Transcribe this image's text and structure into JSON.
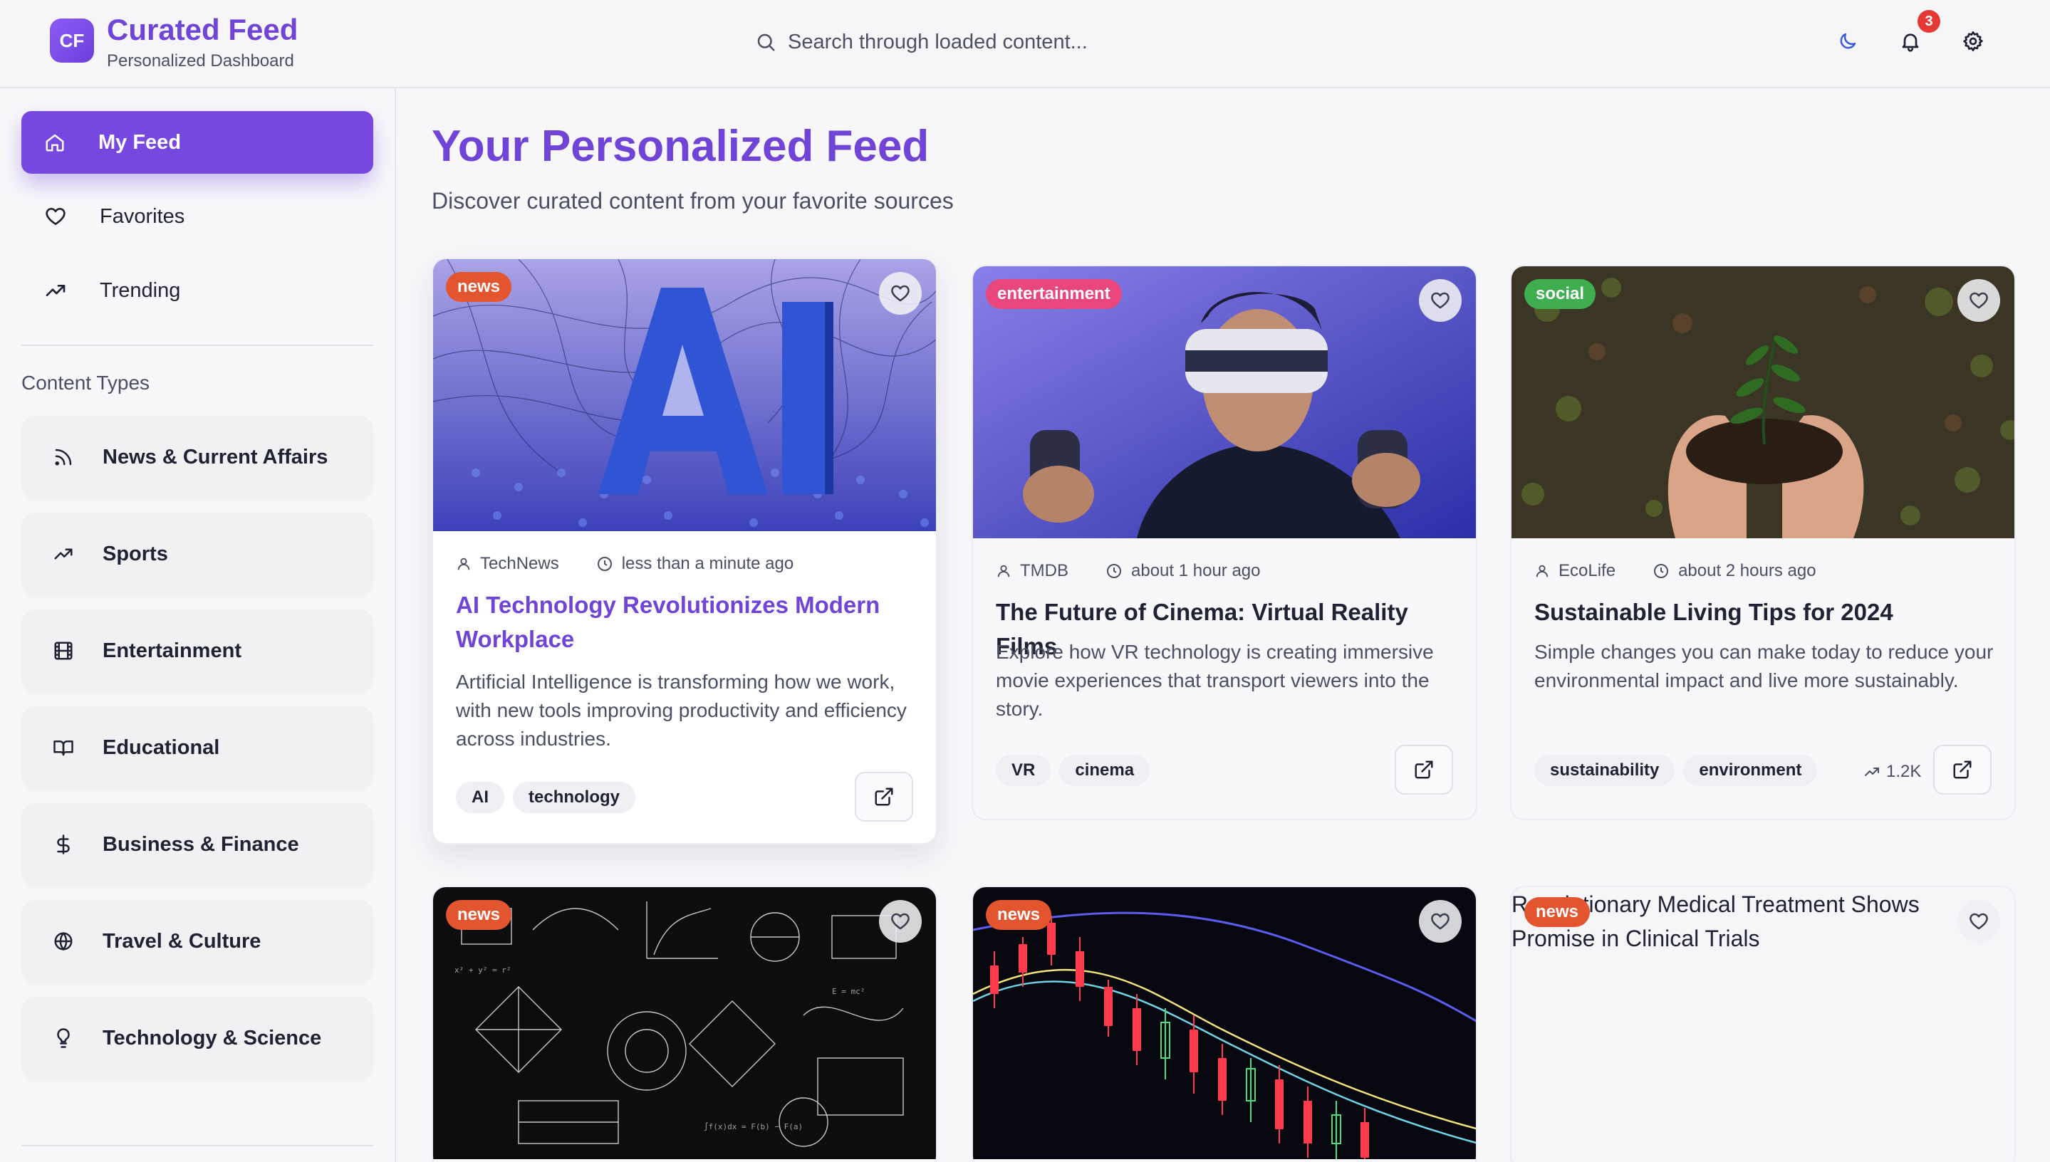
{
  "app": {
    "logo_initials": "CF",
    "title": "Curated Feed",
    "subtitle": "Personalized Dashboard"
  },
  "search": {
    "placeholder": "Search through loaded content...",
    "value": ""
  },
  "header_icons": {
    "theme": "moon-icon",
    "notifications": "bell-icon",
    "notification_count": "3",
    "settings": "gear-icon"
  },
  "sidebar": {
    "nav": [
      {
        "label": "My Feed",
        "icon": "home-icon",
        "active": true
      },
      {
        "label": "Favorites",
        "icon": "heart-icon",
        "active": false
      },
      {
        "label": "Trending",
        "icon": "trending-up-icon",
        "active": false
      }
    ],
    "section_title": "Content Types",
    "content_types": [
      {
        "label": "News & Current Affairs",
        "icon": "rss-icon"
      },
      {
        "label": "Sports",
        "icon": "trending-up-icon"
      },
      {
        "label": "Entertainment",
        "icon": "film-icon"
      },
      {
        "label": "Educational",
        "icon": "book-icon"
      },
      {
        "label": "Business & Finance",
        "icon": "dollar-icon"
      },
      {
        "label": "Travel & Culture",
        "icon": "globe-icon"
      },
      {
        "label": "Technology & Science",
        "icon": "lightbulb-icon"
      }
    ]
  },
  "main": {
    "title": "Your Personalized Feed",
    "subtitle": "Discover curated content from your favorite sources"
  },
  "cards": [
    {
      "category": "news",
      "category_color": "#e2552e",
      "author": "TechNews",
      "time": "less than a minute ago",
      "title": "AI Technology Revolutionizes Modern Workplace",
      "description": "Artificial Intelligence is transforming how we work, with new tools improving productivity and efficiency across industries.",
      "tags": [
        "AI",
        "technology"
      ]
    },
    {
      "category": "entertainment",
      "category_color": "#e8467c",
      "author": "TMDB",
      "time": "about 1 hour ago",
      "title": "The Future of Cinema: Virtual Reality Films",
      "description": "Explore how VR technology is creating immersive movie experiences that transport viewers into the story.",
      "tags": [
        "VR",
        "cinema"
      ]
    },
    {
      "category": "social",
      "category_color": "#3fae4f",
      "author": "EcoLife",
      "time": "about 2 hours ago",
      "title": "Sustainable Living Tips for 2024",
      "description": "Simple changes you can make today to reduce your environmental impact and live more sustainably.",
      "tags": [
        "sustainability",
        "environment"
      ],
      "trend_count": "1.2K"
    },
    {
      "category": "news",
      "category_color": "#e2552e"
    },
    {
      "category": "news",
      "category_color": "#e2552e"
    },
    {
      "category": "news",
      "category_color": "#e2552e",
      "image_alt": "Revolutionary Medical Treatment Shows Promise in Clinical Trials"
    }
  ]
}
